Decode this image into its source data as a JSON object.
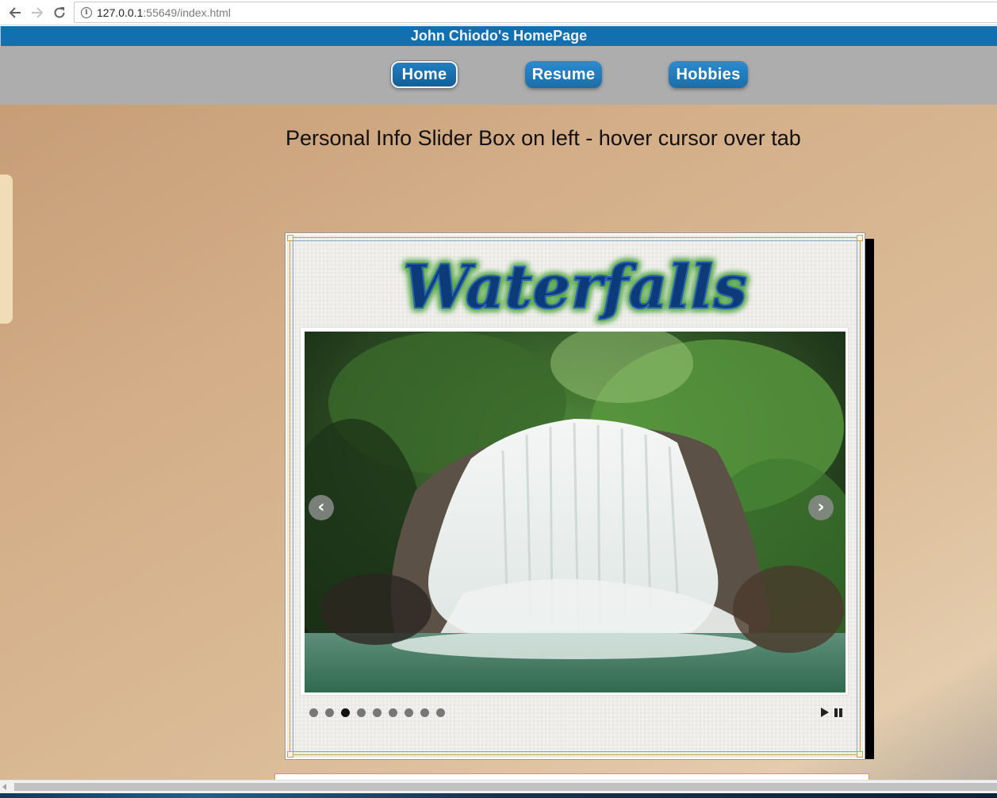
{
  "browser": {
    "url_host": "127.0.0.1",
    "url_rest": ":55649/index.html",
    "info_glyph": "i"
  },
  "site": {
    "title": "John Chiodo's HomePage"
  },
  "menu": {
    "items": [
      {
        "label": "Home",
        "active": true
      },
      {
        "label": "Resume",
        "active": false
      },
      {
        "label": "Hobbies",
        "active": false
      }
    ]
  },
  "main": {
    "heading": "Personal Info Slider Box on left - hover cursor over tab"
  },
  "slideshow": {
    "logo_text": "Waterfalls",
    "prev_glyph": "‹",
    "next_glyph": "›",
    "slide_count": 9,
    "active_slide": 3,
    "colors": {
      "logo_fill": "#0d3a78",
      "logo_glow": "#58a84a",
      "active_dot": "#111111",
      "inactive_dot": "#777777"
    }
  },
  "icons": [
    "back-arrow-icon",
    "forward-arrow-icon",
    "reload-icon",
    "info-icon",
    "prev-arrow-icon",
    "next-arrow-icon",
    "play-icon",
    "pause-icon"
  ]
}
